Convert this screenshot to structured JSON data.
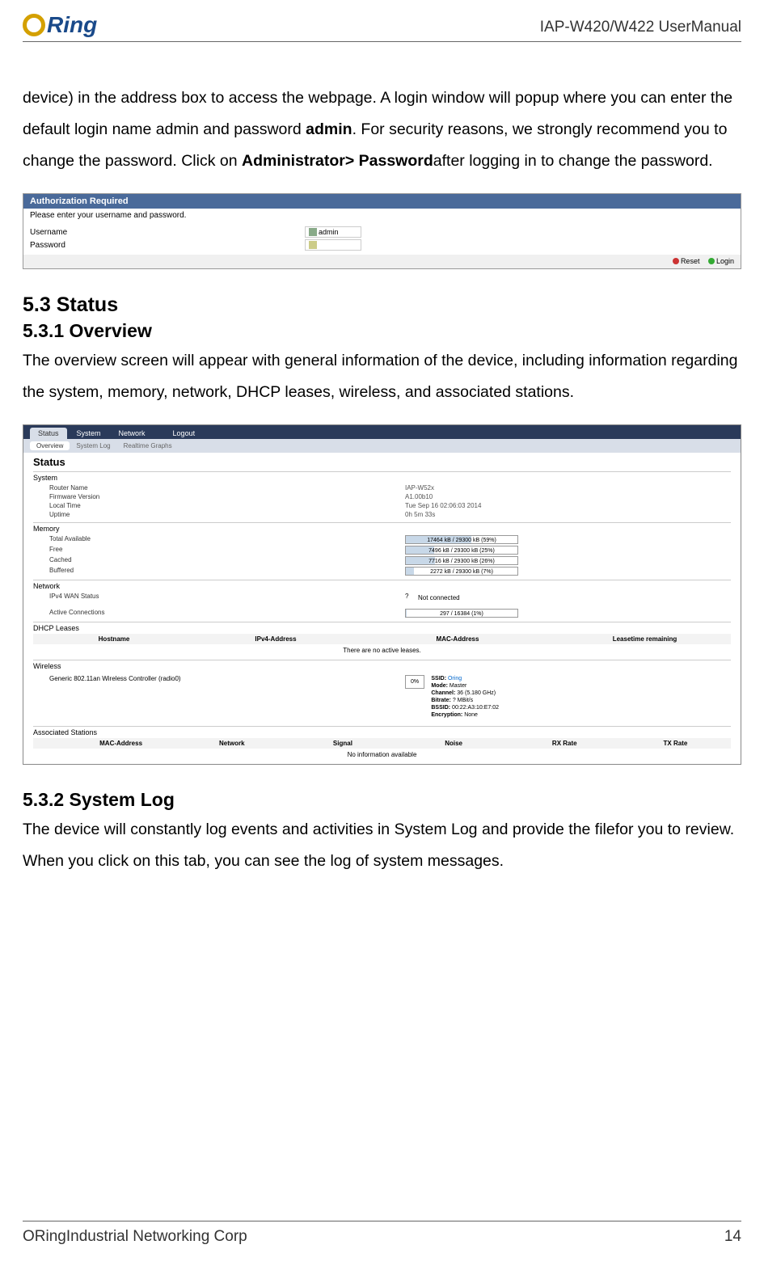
{
  "header": {
    "logo_text": "Ring",
    "doc_title": "IAP-W420/W422  UserManual"
  },
  "intro_para": {
    "part1": "device) in the address box to access the webpage. A login window will popup where you can enter the default login name admin and password ",
    "bold1": "admin",
    "part2": ". For security reasons, we strongly recommend you to change the password. Click on ",
    "bold2": "Administrator> Password",
    "part3": "after logging in to change the password."
  },
  "auth": {
    "title": "Authorization Required",
    "subtitle": "Please enter your username and password.",
    "username_label": "Username",
    "username_value": "admin",
    "password_label": "Password",
    "reset": "Reset",
    "login": "Login"
  },
  "section_5_3": "5.3 Status",
  "section_5_3_1": "5.3.1 Overview",
  "overview_para": "The overview screen will appear with general information of the device, including information regarding the system, memory, network, DHCP leases, wireless, and associated stations.",
  "status": {
    "top_tabs": [
      "Status",
      "System",
      "Network",
      "Logout"
    ],
    "sub_tabs": [
      "Overview",
      "System Log",
      "Realtime Graphs"
    ],
    "title": "Status",
    "system": {
      "heading": "System",
      "router_name_label": "Router Name",
      "router_name_value": "IAP-W52x",
      "fw_label": "Firmware Version",
      "fw_value": "A1.00b10",
      "time_label": "Local Time",
      "time_value": "Tue Sep 16 02:06:03 2014",
      "uptime_label": "Uptime",
      "uptime_value": "0h 5m 33s"
    },
    "memory": {
      "heading": "Memory",
      "total_label": "Total Available",
      "total_value": "17464 kB / 29300 kB (59%)",
      "total_pct": 59,
      "free_label": "Free",
      "free_value": "7496 kB / 29300 kB (25%)",
      "free_pct": 25,
      "cached_label": "Cached",
      "cached_value": "7716 kB / 29300 kB (26%)",
      "cached_pct": 26,
      "buffered_label": "Buffered",
      "buffered_value": "2272 kB / 29300 kB (7%)",
      "buffered_pct": 7
    },
    "network": {
      "heading": "Network",
      "wan_label": "IPv4 WAN Status",
      "wan_value": "Not connected",
      "conn_label": "Active Connections",
      "conn_value": "297 / 16384 (1%)",
      "conn_pct": 1
    },
    "dhcp": {
      "heading": "DHCP Leases",
      "cols": [
        "Hostname",
        "IPv4-Address",
        "MAC-Address",
        "Leasetime remaining"
      ],
      "empty": "There are no active leases."
    },
    "wireless": {
      "heading": "Wireless",
      "controller": "Generic 802.11an Wireless Controller (radio0)",
      "pct": "0%",
      "ssid_l": "SSID:",
      "ssid_v": "Oring",
      "mode_l": "Mode:",
      "mode_v": "Master",
      "channel_l": "Channel:",
      "channel_v": "36 (5.180 GHz)",
      "bitrate_l": "Bitrate:",
      "bitrate_v": "? MBit/s",
      "bssid_l": "BSSID:",
      "bssid_v": "00:22:A3:10:E7:02",
      "encryption_l": "Encryption:",
      "encryption_v": "None"
    },
    "assoc": {
      "heading": "Associated Stations",
      "cols": [
        "MAC-Address",
        "Network",
        "Signal",
        "Noise",
        "RX Rate",
        "TX Rate"
      ],
      "empty": "No information available"
    }
  },
  "section_5_3_2": "5.3.2 System Log",
  "syslog_para": "The device will constantly log events and activities in System Log and provide the filefor you to review. When you click on this tab, you can see the log of system messages.",
  "footer": {
    "company": "ORingIndustrial Networking Corp",
    "page": "14"
  }
}
